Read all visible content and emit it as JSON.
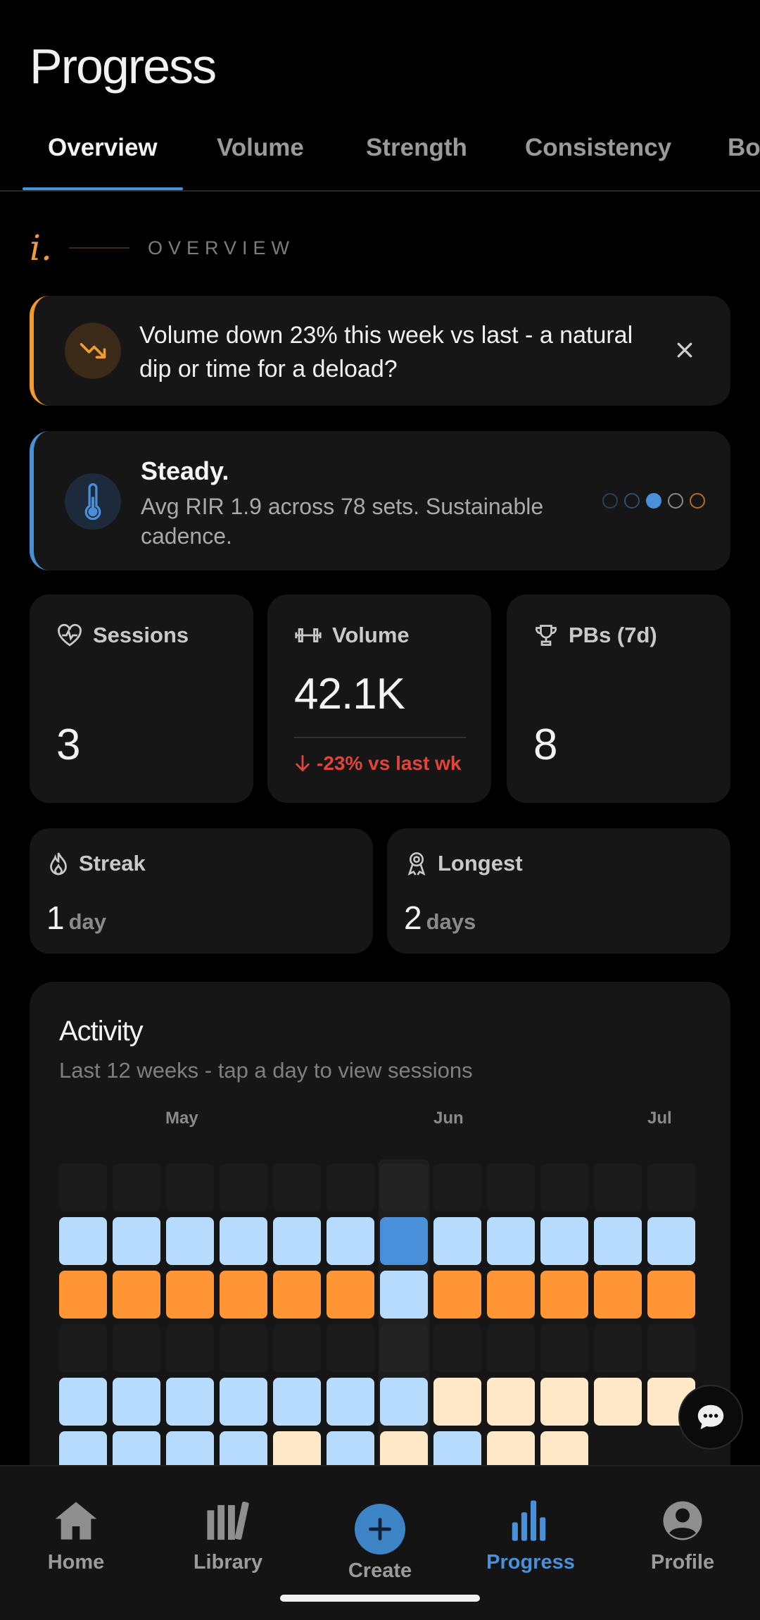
{
  "header": {
    "title": "Progress"
  },
  "tabs": [
    {
      "label": "Overview"
    },
    {
      "label": "Volume"
    },
    {
      "label": "Strength"
    },
    {
      "label": "Consistency"
    },
    {
      "label": "Bo"
    }
  ],
  "section": {
    "index": "i.",
    "label": "OVERVIEW"
  },
  "alert": {
    "text": "Volume down 23% this week vs last - a natural dip or time for a deload?",
    "icon": "trending-down-icon",
    "accent": "#f39b2f"
  },
  "steady": {
    "title": "Steady.",
    "body": "Avg RIR 1.9 across 78 sets. Sustainable cadence.",
    "icon": "thermometer-icon",
    "accent": "#4a8fd9",
    "scale_active_index": 2
  },
  "stats": {
    "sessions": {
      "label": "Sessions",
      "value": "3",
      "icon": "heart-pulse-icon"
    },
    "volume": {
      "label": "Volume",
      "value": "42.1K",
      "delta": "-23% vs last wk",
      "icon": "dumbbell-icon"
    },
    "pbs": {
      "label": "PBs (7d)",
      "value": "8",
      "icon": "trophy-icon"
    }
  },
  "streak": {
    "label": "Streak",
    "value": "1",
    "unit": "day",
    "icon": "flame-icon"
  },
  "longest": {
    "label": "Longest",
    "value": "2",
    "unit": "days",
    "icon": "award-icon"
  },
  "activity": {
    "title": "Activity",
    "subtitle": "Last 12 weeks - tap a day to view sessions",
    "months": [
      "May",
      "Jun",
      "Jul"
    ],
    "highlight_week": 6,
    "colors": {
      "E": "#1b1b1b",
      "L": "#b7dbfd",
      "B": "#4a8fd9",
      "O": "#ff9535",
      "C": "#ffe8c7"
    },
    "rows": [
      "EEEEEEEEEEEE",
      "LLLLLLBLLLLL",
      "OOOOOOLOOOOO",
      "EEEEEEEEEEEE",
      "LLLLLLLCCCCC",
      "LLLLCLCLCC_"
    ]
  },
  "nav": [
    {
      "label": "Home",
      "icon": "home-icon"
    },
    {
      "label": "Library",
      "icon": "library-icon"
    },
    {
      "label": "Create",
      "icon": "plus-icon"
    },
    {
      "label": "Progress",
      "icon": "bar-chart-icon",
      "active": true
    },
    {
      "label": "Profile",
      "icon": "profile-icon"
    }
  ]
}
